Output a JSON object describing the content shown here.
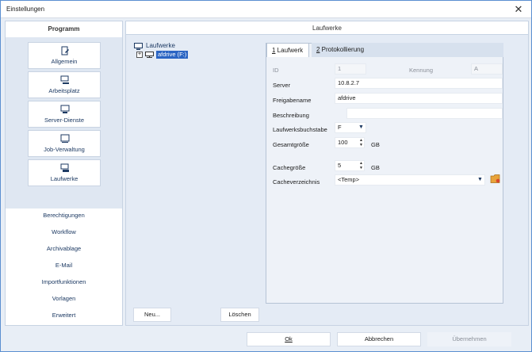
{
  "window": {
    "title": "Einstellungen",
    "close_glyph": "✕"
  },
  "nav": {
    "header": "Programm",
    "tiles": [
      {
        "label": "Allgemein",
        "icon": "general-settings-icon"
      },
      {
        "label": "Arbeitsplatz",
        "icon": "workstation-icon"
      },
      {
        "label": "Server-Dienste",
        "icon": "server-icon"
      },
      {
        "label": "Job-Verwaltung",
        "icon": "job-icon"
      },
      {
        "label": "Laufwerke",
        "icon": "drive-icon"
      }
    ],
    "links": [
      "Berechtigungen",
      "Workflow",
      "Archivablage",
      "E-Mail",
      "Importfunktionen",
      "Vorlagen",
      "Erweitert"
    ]
  },
  "main": {
    "header": "Laufwerke",
    "tree": {
      "root": "Laufwerke",
      "expander": "+",
      "child": "afdrive (F:)"
    },
    "tabs": [
      {
        "key": "1",
        "rest": " Laufwerk"
      },
      {
        "key": "2",
        "rest": " Protokollierung"
      }
    ],
    "form": {
      "id_label": "ID",
      "id_value": "1",
      "kennung_label": "Kennung",
      "kennung_value": "A",
      "server_label": "Server",
      "server_value": "10.8.2.7",
      "freigabe_label": "Freigabename",
      "freigabe_value": "afdrive",
      "beschreibung_label": "Beschreibung",
      "beschreibung_value": "",
      "buchstabe_label": "Laufwerksbuchstabe",
      "buchstabe_value": "F",
      "gesamt_label": "Gesamtgröße",
      "gesamt_value": "100",
      "gesamt_unit": "GB",
      "cache_label": "Cachegröße",
      "cache_value": "5",
      "cache_unit": "GB",
      "cacheverz_label": "Cacheverzeichnis",
      "cacheverz_value": "<Temp>"
    },
    "buttons": {
      "new": "Neu...",
      "delete": "Löschen"
    }
  },
  "footer": {
    "ok": "Ok",
    "cancel": "Abbrechen",
    "apply": "Übernehmen"
  },
  "colors": {
    "accent": "#2a64c3",
    "nav_text": "#1d3a63",
    "folder": "#e8a33a"
  }
}
